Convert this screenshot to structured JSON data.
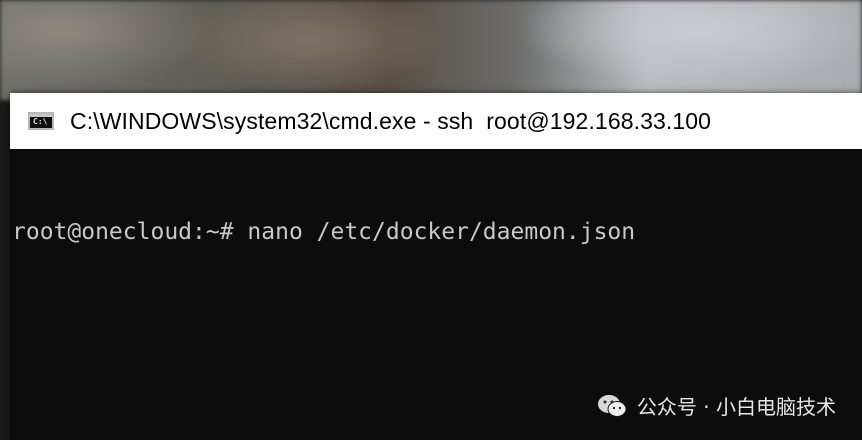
{
  "window": {
    "title": "C:\\WINDOWS\\system32\\cmd.exe - ssh  root@192.168.33.100",
    "icon": "cmd-icon",
    "icon_glyph": "C:\\"
  },
  "console": {
    "lines": [
      "root@onecloud:~# nano /etc/docker/daemon.json"
    ]
  },
  "watermark": {
    "icon": "wechat-icon",
    "text": "公众号 · 小白电脑技术"
  },
  "colors": {
    "console_bg": "#0c0c0c",
    "console_text": "#c8c8c8",
    "titlebar_bg": "#ffffff"
  }
}
